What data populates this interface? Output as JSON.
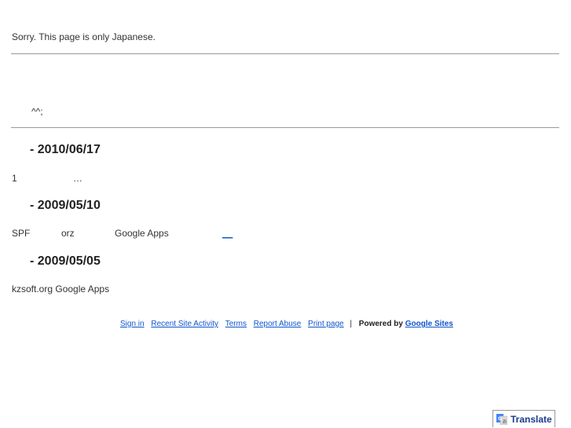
{
  "notice": "Sorry. This page is only Japanese.",
  "intro": "^^;",
  "posts": [
    {
      "title": "- 2010/06/17",
      "segments": [
        "1",
        "…"
      ]
    },
    {
      "title": "- 2009/05/10",
      "segments": [
        "SPF",
        "orz",
        "Google Apps"
      ],
      "link": "__"
    },
    {
      "title": "- 2009/05/05",
      "segments": [
        "kzsoft.org Google Apps"
      ]
    }
  ],
  "footer": {
    "links": [
      "Sign in",
      "Recent Site Activity",
      "Terms",
      "Report Abuse",
      "Print page"
    ],
    "separator": "|",
    "powered_by": "Powered by",
    "brand": "Google Sites"
  },
  "translate": {
    "label": "Translate",
    "icon": "google-translate-icon"
  },
  "colors": {
    "link": "#1155cc",
    "rule": "#9a9a9a",
    "text": "#222222"
  }
}
